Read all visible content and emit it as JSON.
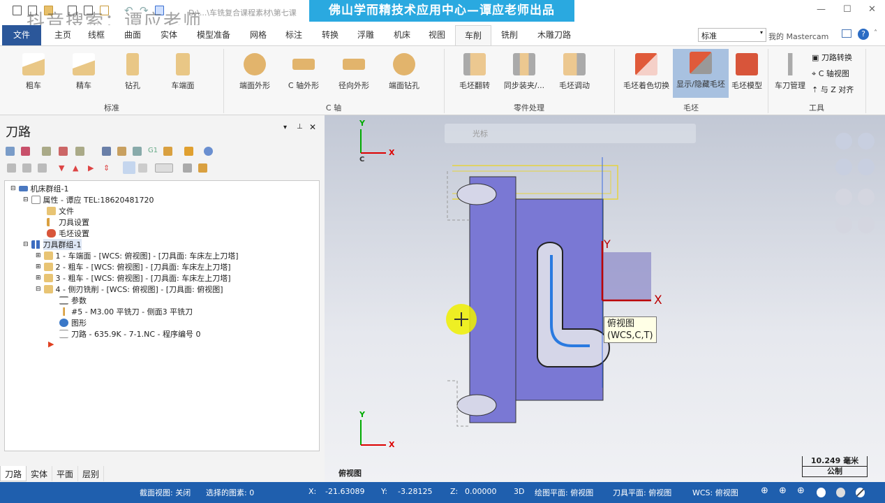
{
  "title": {
    "path": "D:\\...\\车铣复合课程素材\\第七课",
    "banner": "佛山学而精技术应用中心—谭应老师出品",
    "watermark": "抖音搜索：谭应老师"
  },
  "menu": {
    "tabs": [
      "文件",
      "主页",
      "线框",
      "曲面",
      "实体",
      "模型准备",
      "网格",
      "标注",
      "转换",
      "浮雕",
      "机床",
      "视图",
      "车削",
      "铣削",
      "木雕刀路"
    ],
    "active": "车削",
    "dropdown": "标准",
    "my_mastercam": "我的 Mastercam"
  },
  "ribbon": {
    "groups": [
      {
        "label": "标准",
        "buttons": [
          "粗车",
          "精车",
          "钻孔",
          "车端面"
        ]
      },
      {
        "label": "C 轴",
        "buttons": [
          "端面外形",
          "C 轴外形",
          "径向外形",
          "端面钻孔"
        ]
      },
      {
        "label": "零件处理",
        "buttons": [
          "毛坯翻转",
          "同步装夹/...",
          "毛坯调动"
        ]
      },
      {
        "label": "毛坯",
        "buttons": [
          "毛坯着色切换",
          "显示/隐藏毛坯",
          "毛坯模型"
        ]
      },
      {
        "label": "工具",
        "buttons": [
          "车刀管理"
        ],
        "small": [
          "刀路转换",
          "C 轴视图",
          "与 Z 对齐"
        ]
      }
    ]
  },
  "panel": {
    "title": "刀路",
    "bottom_tabs": [
      "刀路",
      "实体",
      "平面",
      "层别"
    ]
  },
  "tree": [
    "机床群组-1",
    "属性 - 谭应 TEL:18620481720",
    "文件",
    "刀具设置",
    "毛坯设置",
    "刀具群组-1",
    "1 - 车端面 - [WCS: 俯视图] - [刀具面: 车床左上刀塔]",
    "2 - 粗车 - [WCS: 俯视图] - [刀具面: 车床左上刀塔]",
    "3 - 粗车 - [WCS: 俯视图] - [刀具面: 车床左上刀塔]",
    "4 - 侧刃铣削 - [WCS: 俯视图] - [刀具面: 俯视图]",
    "参数",
    "#5 - M3.00 平铣刀 - 侧面3 平铣刀",
    "图形",
    "刀路 - 635.9K - 7-1.NC - 程序编号 0"
  ],
  "viewport": {
    "view_label": "俯视图",
    "tooltip_line1": "俯视图",
    "tooltip_line2": "(WCS,C,T)",
    "cursor_label": "光标",
    "scale": "10.249 毫米",
    "units": "公制",
    "axis_x": "X",
    "axis_y": "Y",
    "axis_c": "C"
  },
  "status": {
    "section": "截面视图: 关闭",
    "selected": "选择的图素: 0",
    "x_label": "X:",
    "x": "-21.63089",
    "y_label": "Y:",
    "y": "-3.28125",
    "z_label": "Z:",
    "z": "0.00000",
    "mode": "3D",
    "cplane": "绘图平面: 俯视图",
    "tplane": "刀具平面: 俯视图",
    "wcs": "WCS: 俯视图"
  }
}
